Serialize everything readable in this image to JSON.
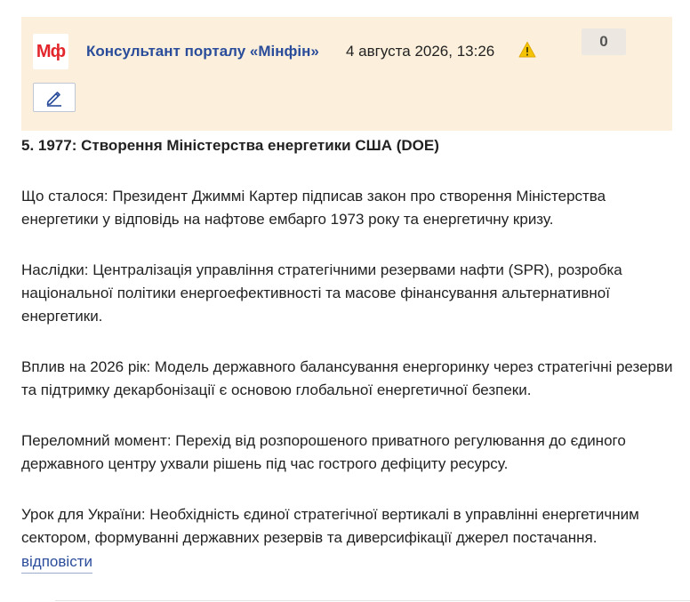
{
  "post": {
    "avatar_text": "Мф",
    "author": "Консультант порталу «Мінфін»",
    "date": "4 августа 2026, 13:26",
    "rating": "0",
    "colors": {
      "header_bg": "#fcf0dc",
      "author_link": "#2a4c9a",
      "avatar_text": "#e3262b",
      "warning": "#f5c400"
    },
    "icons": {
      "warning": "warning-icon",
      "edit": "pencil-icon"
    }
  },
  "content": {
    "heading": "5. 1977: Створення Міністерства енергетики США (DOE)",
    "paragraphs": [
      "Що сталося: Президент Джиммі Картер підписав закон про створення Міністерства енергетики у відповідь на нафтове ембарго 1973 року та енергетичну кризу.",
      "Наслідки: Централізація управління стратегічними резервами нафти (SPR), розробка національної політики енергоефективності та масове фінансування альтернативної енергетики.",
      "Вплив на 2026 рік: Модель державного балансування енергоринку через стратегічні резерви та підтримку декарбонізації є основою глобальної енергетичної безпеки.",
      "Переломний момент: Перехід від розпорошеного приватного регулювання до єдиного державного центру ухвали рішень під час гострого дефіциту ресурсу.",
      "Урок для України: Необхідність єдиної стратегічної вертикалі в управлінні енергетичним сектором, формуванні державних резервів та диверсифікації джерел постачання."
    ]
  },
  "actions": {
    "reply_label": "відповісти"
  }
}
